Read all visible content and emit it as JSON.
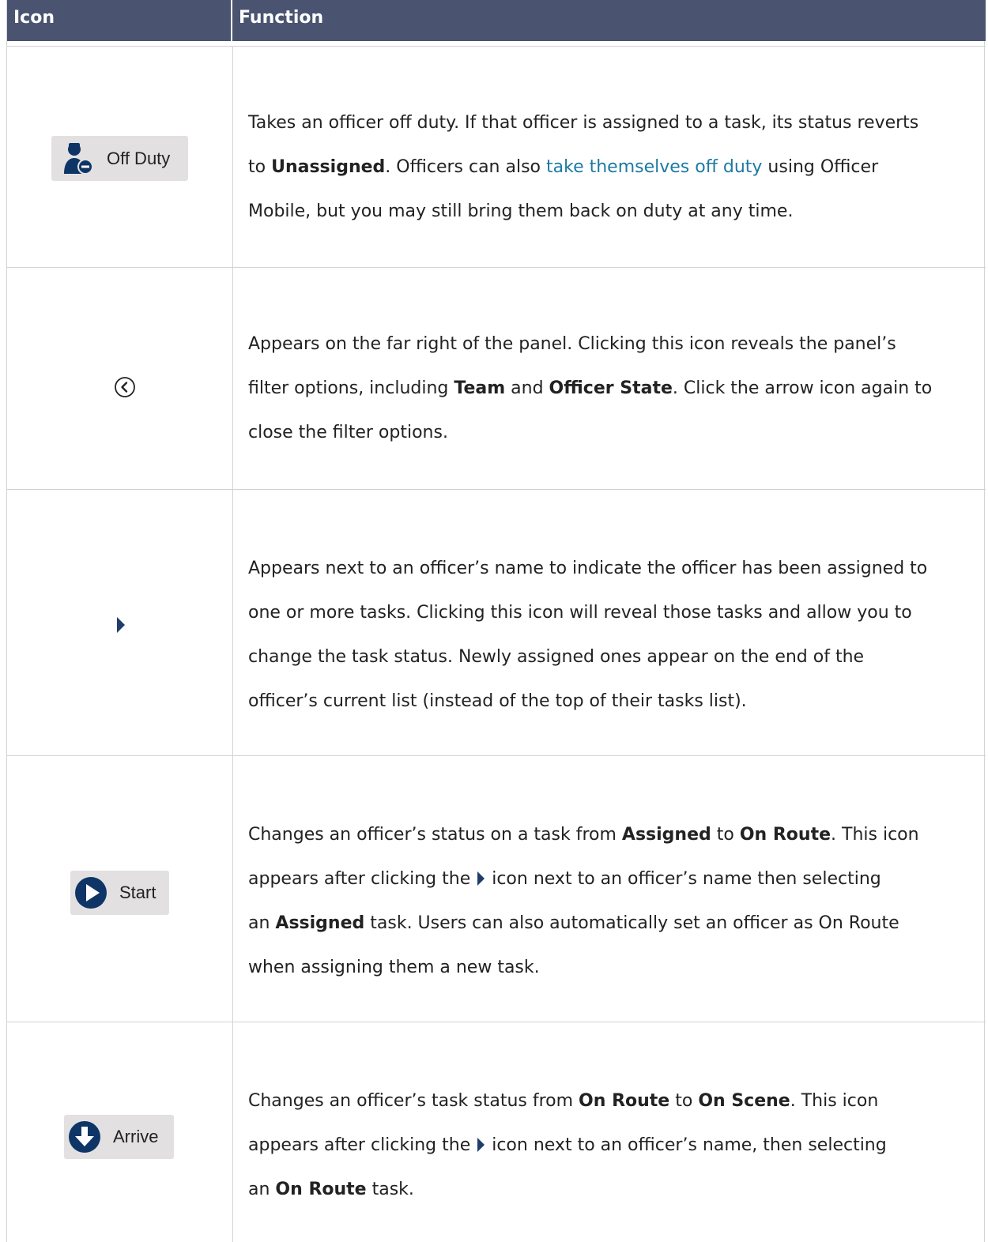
{
  "header": {
    "col_icon": "Icon",
    "col_function": "Function"
  },
  "colors": {
    "header_bg": "#4a5470",
    "icon_blue": "#0e3566",
    "link": "#1d7aa3"
  },
  "rows": [
    {
      "icon": "off-duty-icon",
      "button_label": "Off Duty",
      "line1": "Takes an officer off duty. If that officer is assigned to a task, its status reverts",
      "line2_pre": "to ",
      "line2_b1": "Unassigned",
      "line2_mid": ". Officers can also ",
      "line2_link": "take themselves off duty",
      "line2_post": " using Officer",
      "line3": "Mobile, but you may still bring them back on duty at any time."
    },
    {
      "icon": "chevron-left-circle-icon",
      "line1": "Appears on the far right of the panel. Clicking this icon reveals the panel’s",
      "line2_pre": "filter options, including ",
      "line2_b1": "Team",
      "line2_mid": " and ",
      "line2_b2": "Officer State",
      "line2_post": ". Click the arrow icon again to",
      "line3": "close the filter options."
    },
    {
      "icon": "expand-triangle-icon",
      "line1": "Appears next to an officer’s name to indicate the officer has been assigned to",
      "line2": "one or more tasks. Clicking this icon will reveal those tasks and allow you to",
      "line3": "change the task status. Newly assigned ones appear on the end of the",
      "line4": "officer’s current list (instead of the top of their tasks list)."
    },
    {
      "icon": "play-circle-icon",
      "button_label": "Start",
      "line1_pre": "Changes an officer’s status on a task from ",
      "line1_b1": "Assigned",
      "line1_mid": " to ",
      "line1_b2": "On Route",
      "line1_post": ". This icon",
      "line2_pre": "appears after clicking the ",
      "line2_post": " icon next to an officer’s name then selecting",
      "line3_pre": "an ",
      "line3_b1": "Assigned",
      "line3_post": " task. Users can also automatically set an officer as On Route",
      "line4": "when assigning them a new task."
    },
    {
      "icon": "arrow-down-circle-icon",
      "button_label": "Arrive",
      "line1_pre": "Changes an officer’s task status from ",
      "line1_b1": "On Route",
      "line1_mid": " to ",
      "line1_b2": "On Scene",
      "line1_post": ". This icon",
      "line2_pre": "appears after clicking the ",
      "line2_post": " icon next to an officer’s name, then selecting",
      "line3_pre": "an ",
      "line3_b1": "On Route",
      "line3_post": " task."
    }
  ]
}
